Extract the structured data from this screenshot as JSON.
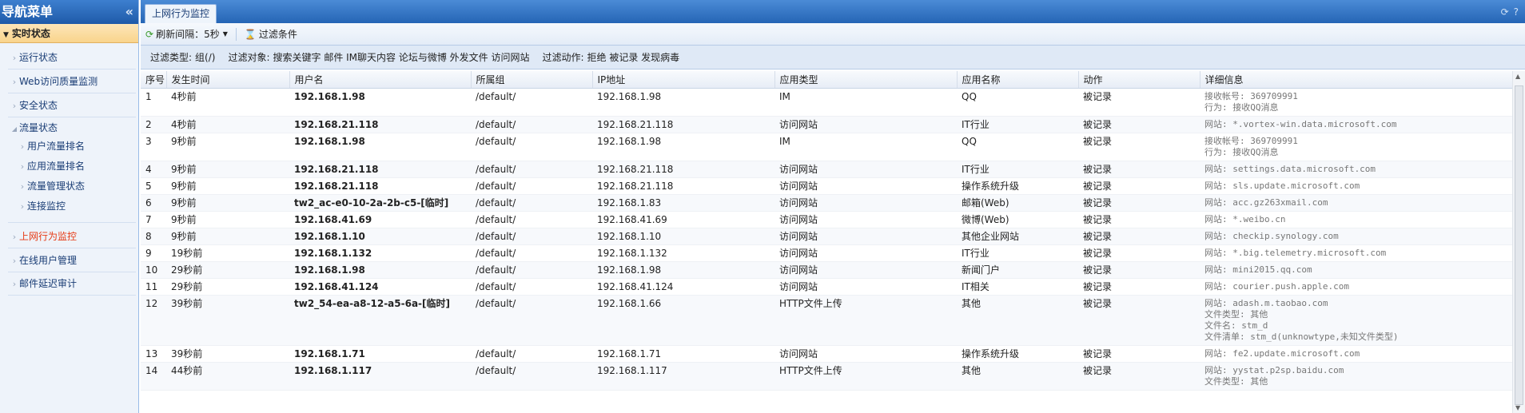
{
  "nav": {
    "title": "导航菜单",
    "collapse_icon": "«",
    "section": "实时状态",
    "items": [
      {
        "label": "运行状态"
      },
      {
        "label": "Web访问质量监测"
      },
      {
        "label": "安全状态"
      },
      {
        "label": "流量状态"
      },
      {
        "label": "用户流量排名"
      },
      {
        "label": "应用流量排名"
      },
      {
        "label": "流量管理状态"
      },
      {
        "label": "连接监控"
      },
      {
        "label": "上网行为监控"
      },
      {
        "label": "在线用户管理"
      },
      {
        "label": "邮件延迟审计"
      }
    ]
  },
  "tab": {
    "label": "上网行为监控"
  },
  "toolbar": {
    "refresh_label": "刷新间隔：5秒",
    "filter_label": "过滤条件"
  },
  "filters": {
    "type_label": "过滤类型:",
    "type_value": "组(/)",
    "object_label": "过滤对象:",
    "object_value": "搜索关键字 邮件 IM聊天内容 论坛与微博 外发文件 访问网站",
    "action_label": "过滤动作:",
    "action_value": "拒绝 被记录 发现病毒"
  },
  "table": {
    "headers": [
      "序号",
      "发生时间",
      "用户名",
      "所属组",
      "IP地址",
      "应用类型",
      "应用名称",
      "动作",
      "详细信息"
    ],
    "rows": [
      {
        "no": "1",
        "time": "4秒前",
        "user": "192.168.1.98",
        "group": "/default/",
        "ip": "192.168.1.98",
        "app_type": "IM",
        "app_name": "QQ",
        "action": "被记录",
        "detail": [
          "接收帐号: 369709991",
          "行为: 接收QQ消息"
        ]
      },
      {
        "no": "2",
        "time": "4秒前",
        "user": "192.168.21.118",
        "group": "/default/",
        "ip": "192.168.21.118",
        "app_type": "访问网站",
        "app_name": "IT行业",
        "action": "被记录",
        "detail": [
          "网站: *.vortex-win.data.microsoft.com"
        ]
      },
      {
        "no": "3",
        "time": "9秒前",
        "user": "192.168.1.98",
        "group": "/default/",
        "ip": "192.168.1.98",
        "app_type": "IM",
        "app_name": "QQ",
        "action": "被记录",
        "detail": [
          "接收帐号: 369709991",
          "行为: 接收QQ消息"
        ]
      },
      {
        "no": "4",
        "time": "9秒前",
        "user": "192.168.21.118",
        "group": "/default/",
        "ip": "192.168.21.118",
        "app_type": "访问网站",
        "app_name": "IT行业",
        "action": "被记录",
        "detail": [
          "网站: settings.data.microsoft.com"
        ]
      },
      {
        "no": "5",
        "time": "9秒前",
        "user": "192.168.21.118",
        "group": "/default/",
        "ip": "192.168.21.118",
        "app_type": "访问网站",
        "app_name": "操作系统升级",
        "action": "被记录",
        "detail": [
          "网站: sls.update.microsoft.com"
        ]
      },
      {
        "no": "6",
        "time": "9秒前",
        "user": "tw2_ac-e0-10-2a-2b-c5-[临时]",
        "group": "/default/",
        "ip": "192.168.1.83",
        "app_type": "访问网站",
        "app_name": "邮箱(Web)",
        "action": "被记录",
        "detail": [
          "网站: acc.gz263xmail.com"
        ]
      },
      {
        "no": "7",
        "time": "9秒前",
        "user": "192.168.41.69",
        "group": "/default/",
        "ip": "192.168.41.69",
        "app_type": "访问网站",
        "app_name": "微博(Web)",
        "action": "被记录",
        "detail": [
          "网站: *.weibo.cn"
        ]
      },
      {
        "no": "8",
        "time": "9秒前",
        "user": "192.168.1.10",
        "group": "/default/",
        "ip": "192.168.1.10",
        "app_type": "访问网站",
        "app_name": "其他企业网站",
        "action": "被记录",
        "detail": [
          "网站: checkip.synology.com"
        ]
      },
      {
        "no": "9",
        "time": "19秒前",
        "user": "192.168.1.132",
        "group": "/default/",
        "ip": "192.168.1.132",
        "app_type": "访问网站",
        "app_name": "IT行业",
        "action": "被记录",
        "detail": [
          "网站: *.big.telemetry.microsoft.com"
        ]
      },
      {
        "no": "10",
        "time": "29秒前",
        "user": "192.168.1.98",
        "group": "/default/",
        "ip": "192.168.1.98",
        "app_type": "访问网站",
        "app_name": "新闻门户",
        "action": "被记录",
        "detail": [
          "网站: mini2015.qq.com"
        ]
      },
      {
        "no": "11",
        "time": "29秒前",
        "user": "192.168.41.124",
        "group": "/default/",
        "ip": "192.168.41.124",
        "app_type": "访问网站",
        "app_name": "IT相关",
        "action": "被记录",
        "detail": [
          "网站: courier.push.apple.com"
        ]
      },
      {
        "no": "12",
        "time": "39秒前",
        "user": "tw2_54-ea-a8-12-a5-6a-[临时]",
        "group": "/default/",
        "ip": "192.168.1.66",
        "app_type": "HTTP文件上传",
        "app_name": "其他",
        "action": "被记录",
        "detail": [
          "网站: adash.m.taobao.com",
          "文件类型: 其他",
          "文件名: stm_d",
          "文件清单: stm_d(unknowtype,未知文件类型)"
        ]
      },
      {
        "no": "13",
        "time": "39秒前",
        "user": "192.168.1.71",
        "group": "/default/",
        "ip": "192.168.1.71",
        "app_type": "访问网站",
        "app_name": "操作系统升级",
        "action": "被记录",
        "detail": [
          "网站: fe2.update.microsoft.com"
        ]
      },
      {
        "no": "14",
        "time": "44秒前",
        "user": "192.168.1.117",
        "group": "/default/",
        "ip": "192.168.1.117",
        "app_type": "HTTP文件上传",
        "app_name": "其他",
        "action": "被记录",
        "detail": [
          "网站: yystat.p2sp.baidu.com",
          "文件类型: 其他"
        ]
      }
    ]
  }
}
